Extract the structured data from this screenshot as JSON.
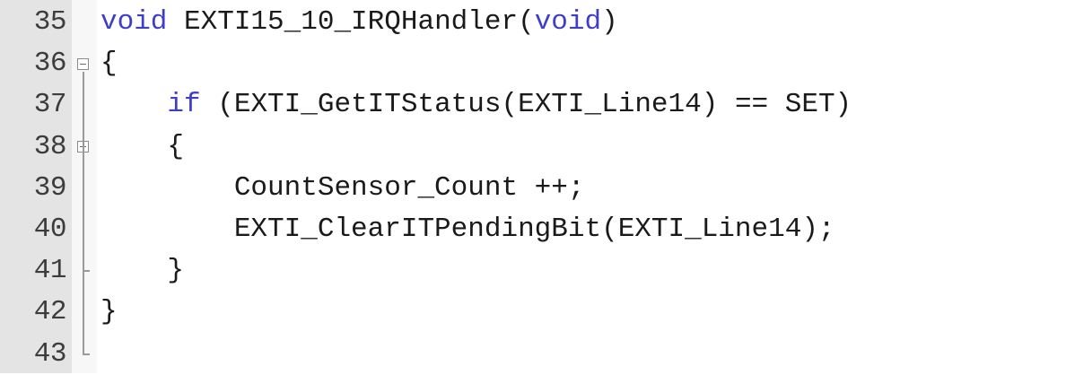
{
  "editor": {
    "lines": [
      {
        "num": "35",
        "parts": [
          {
            "t": "void",
            "c": "kw"
          },
          {
            "t": " EXTI15_10_IRQHandler(",
            "c": ""
          },
          {
            "t": "void",
            "c": "kw"
          },
          {
            "t": ")",
            "c": ""
          }
        ]
      },
      {
        "num": "36",
        "parts": [
          {
            "t": "{",
            "c": ""
          }
        ]
      },
      {
        "num": "37",
        "parts": [
          {
            "t": "    ",
            "c": ""
          },
          {
            "t": "if",
            "c": "kw"
          },
          {
            "t": " (EXTI_GetITStatus(EXTI_Line14) == SET)",
            "c": ""
          }
        ]
      },
      {
        "num": "38",
        "parts": [
          {
            "t": "    {",
            "c": ""
          }
        ]
      },
      {
        "num": "39",
        "parts": [
          {
            "t": "        CountSensor_Count ++;",
            "c": ""
          }
        ]
      },
      {
        "num": "40",
        "parts": [
          {
            "t": "        EXTI_ClearITPendingBit(EXTI_Line14);",
            "c": ""
          }
        ]
      },
      {
        "num": "41",
        "parts": [
          {
            "t": "    }",
            "c": ""
          }
        ]
      },
      {
        "num": "42",
        "parts": [
          {
            "t": "}",
            "c": ""
          }
        ]
      },
      {
        "num": "43",
        "parts": []
      }
    ]
  },
  "colors": {
    "keyword": "#3e3ec8",
    "text": "#1a1a1a",
    "gutter": "#e4e4e4"
  }
}
